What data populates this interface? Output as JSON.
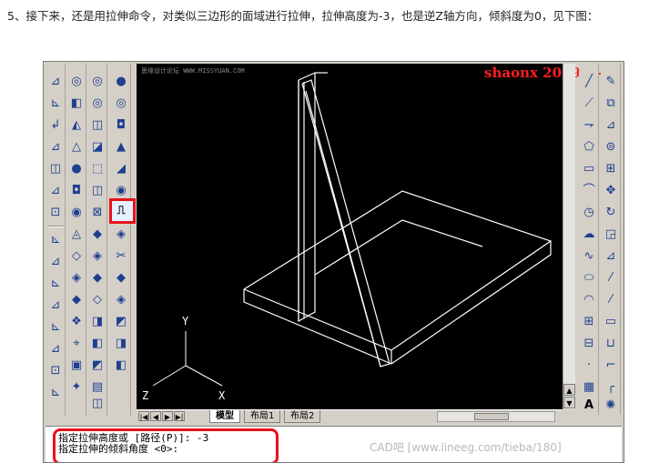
{
  "intro_text": "5、接下来，还是用拉伸命令，对类似三边形的面域进行拉伸，拉伸高度为-3，也是逆Z轴方向，倾斜度为0，见下图：",
  "canvas": {
    "signature": "shaonx 2009-7-26",
    "tiny_watermark": "思缘设计论坛 WWW.MISSYUAN.COM",
    "ucs": {
      "x_label": "X",
      "y_label": "Y",
      "z_label": "Z"
    }
  },
  "tabs": [
    {
      "label": "模型",
      "active": true
    },
    {
      "label": "布局1",
      "active": false
    },
    {
      "label": "布局2",
      "active": false
    }
  ],
  "tab_nav": [
    "|◀",
    "◀",
    "▶",
    "▶|"
  ],
  "command": {
    "line1": "指定拉伸高度或 [路径(P)]: -3",
    "line2": "指定拉伸的倾斜角度 <0>:",
    "watermark": "CAD吧 [www.lineeg.com/tieba/180]"
  },
  "icons": {
    "col1": [
      "ucs-icon",
      "ucs-world-icon",
      "ucs-prev-icon",
      "ucs-3point-icon",
      "ucs-face-icon",
      "ucs-object-icon",
      "ucs-view-icon",
      "ucs-origin-icon",
      "ucs-zaxis-icon",
      "ucs-x-icon",
      "ucs-y-icon",
      "ucs-z-icon",
      "ucs-apply-icon",
      "ucs-named-icon",
      "ucs-settings-icon"
    ],
    "col2": [
      "orbit-icon",
      "box-icon",
      "wedge-icon",
      "cone-icon",
      "sphere-icon",
      "cylinder-icon",
      "torus-icon",
      "pyramid-icon",
      "polysolid-icon",
      "section-icon",
      "slice-icon",
      "interfere-icon",
      "camera-icon",
      "render-icon",
      "light-icon",
      "material-icon",
      "mapping-icon",
      "background-icon",
      "fog-icon",
      "landscape-icon"
    ],
    "col3": [
      "sphere-icon",
      "cylinder-icon",
      "cone-icon",
      "wedge-icon",
      "torus-icon",
      "extrude-icon",
      "revolve-icon",
      "box3d-icon",
      "mesh-icon",
      "surface-icon",
      "union-icon",
      "subtract-icon",
      "intersect-icon",
      "shade-icon",
      "hide-icon",
      "render-icon"
    ],
    "col4": [
      "line-icon",
      "construction-line-icon",
      "polyline-icon",
      "polygon-icon",
      "rectangle-icon",
      "arc-icon",
      "circle-icon",
      "revcloud-icon",
      "spline-icon",
      "ellipse-icon",
      "ellipse-arc-icon",
      "insert-block-icon",
      "make-block-icon",
      "point-icon",
      "hatch-icon",
      "gradient-icon",
      "region-icon",
      "table-icon",
      "multiline-text-icon"
    ],
    "col5": [
      "erase-icon",
      "copy-icon",
      "mirror-icon",
      "offset-icon",
      "array-icon",
      "move-icon",
      "rotate-icon",
      "scale-icon",
      "stretch-icon",
      "trim-icon",
      "extend-icon",
      "break-icon",
      "join-icon",
      "chamfer-icon",
      "fillet-icon",
      "explode-icon"
    ]
  }
}
